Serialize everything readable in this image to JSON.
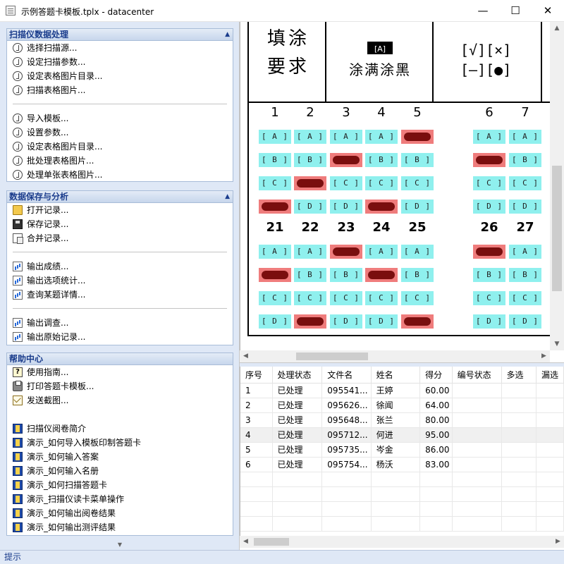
{
  "window": {
    "title": "示例答题卡模板.tplx - datacenter",
    "min_glyph": "—",
    "max_glyph": "☐",
    "close_glyph": "✕"
  },
  "scanner_group": {
    "title": "扫描仪数据处理",
    "items": [
      "选择扫描源...",
      "设定扫描参数...",
      "设定表格图片目录...",
      "扫描表格图片...",
      "导入模板...",
      "设置参数...",
      "设定表格图片目录...",
      "批处理表格图片...",
      "处理单张表格图片..."
    ]
  },
  "save_group": {
    "title": "数据保存与分析",
    "items": [
      "打开记录...",
      "保存记录...",
      "合并记录...",
      "输出成绩...",
      "输出选项统计...",
      "查询某题详情...",
      "输出调查...",
      "输出原始记录..."
    ]
  },
  "help_group": {
    "title": "帮助中心",
    "items": [
      "使用指南...",
      "打印答题卡模板...",
      "发送截图...",
      "扫描仪阅卷简介",
      "演示_如何导入模板印制答题卡",
      "演示_如何输入答案",
      "演示_如何输入名册",
      "演示_如何扫描答题卡",
      "演示_扫描仪读卡菜单操作",
      "演示_如何输出阅卷结果",
      "演示_如何输出测评结果"
    ]
  },
  "status": {
    "text": "提示"
  },
  "sheet": {
    "fill_title_line1": "填涂",
    "fill_title_line2": "要求",
    "fill_sample": "[A]",
    "fill_desc": "涂满涂黑",
    "marks_line1": "[√][×]",
    "marks_line2": "[—][●]",
    "bubble_colors": {
      "empty": "#8ff0ee",
      "filled": "#ef7c7c",
      "mark": "#7a0e0e"
    },
    "row1_numbers": [
      "1",
      "2",
      "3",
      "4",
      "5",
      "6",
      "7"
    ],
    "row2_numbers": [
      "21",
      "22",
      "23",
      "24",
      "25",
      "26",
      "27"
    ],
    "options": [
      "A",
      "B",
      "C",
      "D"
    ],
    "filled_row1": {
      "1": "D",
      "2": "C",
      "3": "B",
      "4": "D",
      "5": "A",
      "6": "B"
    },
    "filled_row2": {
      "21": "B",
      "22": "D",
      "23": "A",
      "24": "B",
      "25": "D",
      "26": "A"
    }
  },
  "grid": {
    "columns": [
      "序号",
      "处理状态",
      "文件名",
      "姓名",
      "得分",
      "编号状态",
      "多选",
      "漏选"
    ],
    "rows": [
      [
        "1",
        "已处理",
        "095541...",
        "王婷",
        "60.00",
        "",
        "",
        ""
      ],
      [
        "2",
        "已处理",
        "095626...",
        "徐闻",
        "64.00",
        "",
        "",
        ""
      ],
      [
        "3",
        "已处理",
        "095648...",
        "张兰",
        "80.00",
        "",
        "",
        ""
      ],
      [
        "4",
        "已处理",
        "095712...",
        "何进",
        "95.00",
        "",
        "",
        ""
      ],
      [
        "5",
        "已处理",
        "095735...",
        "岑金",
        "86.00",
        "",
        "",
        ""
      ],
      [
        "6",
        "已处理",
        "095754...",
        "杨沃",
        "83.00",
        "",
        "",
        ""
      ]
    ],
    "selected_row": 3
  }
}
